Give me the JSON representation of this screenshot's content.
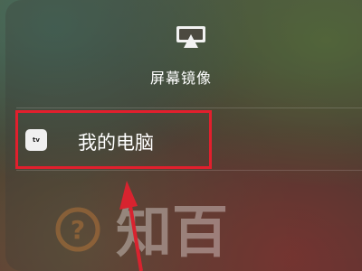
{
  "screen_mirroring": {
    "title": "屏幕镜像",
    "icon": "airplay-icon",
    "devices": [
      {
        "icon": "appletv-icon",
        "icon_text": "tv",
        "label": "我的电脑"
      }
    ]
  },
  "annotation": {
    "box_color": "#e21f2d",
    "arrow_color": "#d8232f"
  },
  "watermark": {
    "icon": "question-mark-icon",
    "glyph": "?",
    "text": "知百"
  }
}
